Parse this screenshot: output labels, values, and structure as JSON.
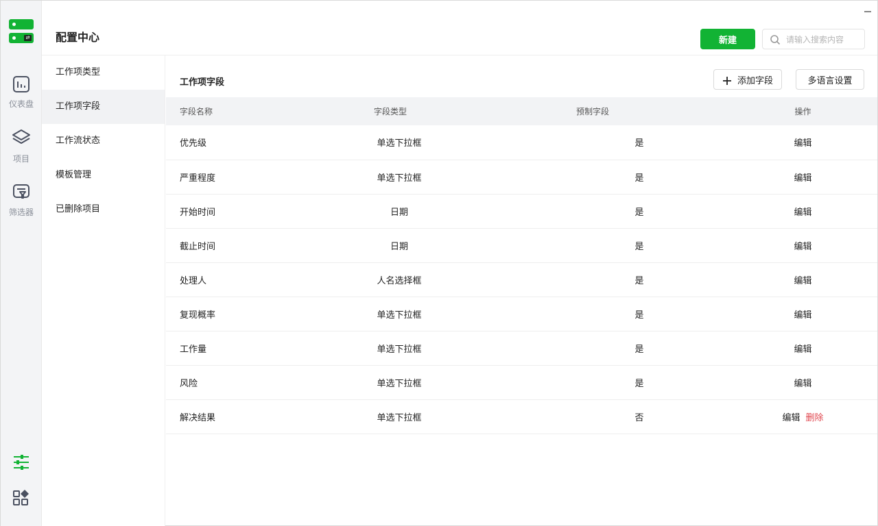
{
  "app": {
    "title": "配置中心",
    "new_button": "新建",
    "search_placeholder": "请输入搜索内容"
  },
  "rail": [
    {
      "label": "仪表盘",
      "icon": "chart-icon"
    },
    {
      "label": "项目",
      "icon": "layers-icon"
    },
    {
      "label": "筛选器",
      "icon": "filter-icon"
    }
  ],
  "subnav": [
    {
      "label": "工作项类型",
      "active": false
    },
    {
      "label": "工作项字段",
      "active": true
    },
    {
      "label": "工作流状态",
      "active": false
    },
    {
      "label": "模板管理",
      "active": false
    },
    {
      "label": "已删除项目",
      "active": false
    }
  ],
  "section": {
    "title": "工作项字段",
    "add_button": "添加字段",
    "lang_button": "多语言设置"
  },
  "table": {
    "headers": [
      "字段名称",
      "字段类型",
      "预制字段",
      "操作"
    ],
    "edit_label": "编辑",
    "delete_label": "删除",
    "rows": [
      {
        "name": "优先级",
        "type": "单选下拉框",
        "preset": "是"
      },
      {
        "name": "严重程度",
        "type": "单选下拉框",
        "preset": "是"
      },
      {
        "name": "开始时间",
        "type": "日期",
        "preset": "是"
      },
      {
        "name": "截止时间",
        "type": "日期",
        "preset": "是"
      },
      {
        "name": "处理人",
        "type": "人名选择框",
        "preset": "是"
      },
      {
        "name": "复现概率",
        "type": "单选下拉框",
        "preset": "是"
      },
      {
        "name": "工作量",
        "type": "单选下拉框",
        "preset": "是"
      },
      {
        "name": "风险",
        "type": "单选下拉框",
        "preset": "是"
      },
      {
        "name": "解决结果",
        "type": "单选下拉框",
        "preset": "否"
      }
    ]
  },
  "colors": {
    "accent": "#12b334",
    "danger": "#e0474f"
  }
}
